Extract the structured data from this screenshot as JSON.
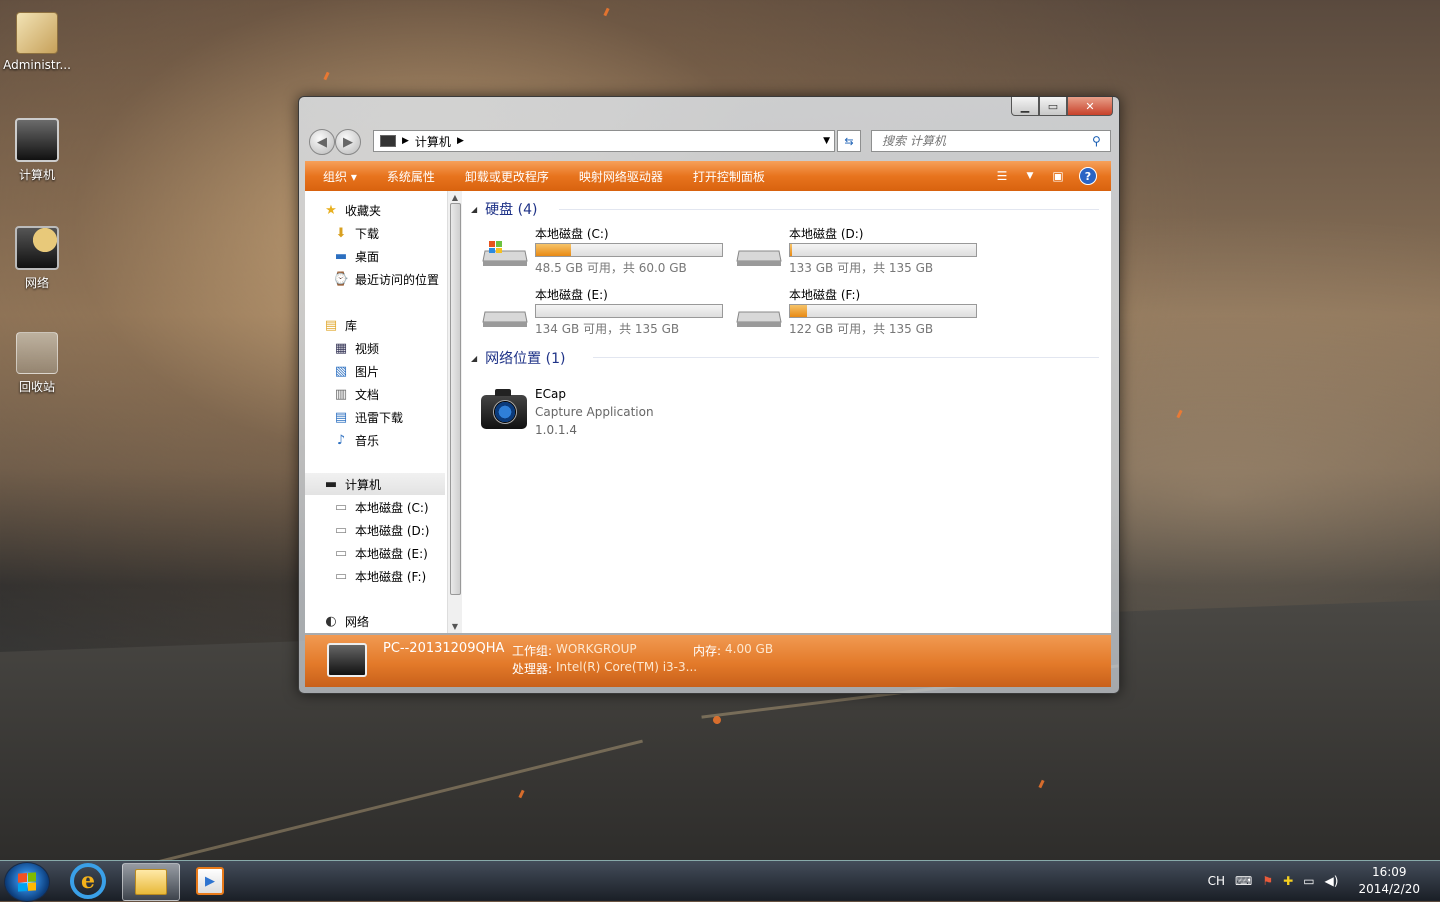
{
  "desktop": {
    "icons": [
      {
        "label": "Administr...",
        "icon": "user-folder-icon"
      },
      {
        "label": "计算机",
        "icon": "computer-icon"
      },
      {
        "label": "网络",
        "icon": "network-icon"
      },
      {
        "label": "回收站",
        "icon": "recycle-bin-icon"
      }
    ]
  },
  "window": {
    "caption": {
      "minimize": "▁",
      "maximize": "▭",
      "close": "✕"
    },
    "address": {
      "segments": [
        "计算机"
      ]
    },
    "search": {
      "placeholder": "搜索 计算机"
    },
    "toolbar": {
      "organize": "组织 ▾",
      "system_properties": "系统属性",
      "uninstall": "卸载或更改程序",
      "map_drive": "映射网络驱动器",
      "control_panel": "打开控制面板",
      "help": "?"
    },
    "nav": {
      "favorites": "收藏夹",
      "downloads": "下载",
      "desktop": "桌面",
      "recent": "最近访问的位置",
      "libraries": "库",
      "videos": "视频",
      "pictures": "图片",
      "documents": "文档",
      "xunlei": "迅雷下载",
      "music": "音乐",
      "computer": "计算机",
      "drive_c": "本地磁盘 (C:)",
      "drive_d": "本地磁盘 (D:)",
      "drive_e": "本地磁盘 (E:)",
      "drive_f": "本地磁盘 (F:)",
      "network": "网络"
    },
    "groups": {
      "hard_disks": "硬盘 (4)",
      "network_locations": "网络位置 (1)"
    },
    "drives": [
      {
        "name": "本地磁盘 (C:)",
        "size": "48.5 GB 可用，共 60.0 GB",
        "used_fraction": 0.19
      },
      {
        "name": "本地磁盘 (D:)",
        "size": "133 GB 可用，共 135 GB",
        "used_fraction": 0.01
      },
      {
        "name": "本地磁盘 (E:)",
        "size": "134 GB 可用，共 135 GB",
        "used_fraction": 0.0
      },
      {
        "name": "本地磁盘 (F:)",
        "size": "122 GB 可用，共 135 GB",
        "used_fraction": 0.09
      }
    ],
    "network_item": {
      "name": "ECap",
      "description": "Capture Application",
      "version": "1.0.1.4"
    },
    "details": {
      "computer_name": "PC--20131209QHA",
      "workgroup_label": "工作组:",
      "workgroup": "WORKGROUP",
      "memory_label": "内存:",
      "memory": "4.00 GB",
      "processor_label": "处理器:",
      "processor": "Intel(R) Core(TM) i3-3..."
    }
  },
  "taskbar": {
    "tray": {
      "language": "CH",
      "time": "16:09",
      "date": "2014/2/20"
    }
  }
}
